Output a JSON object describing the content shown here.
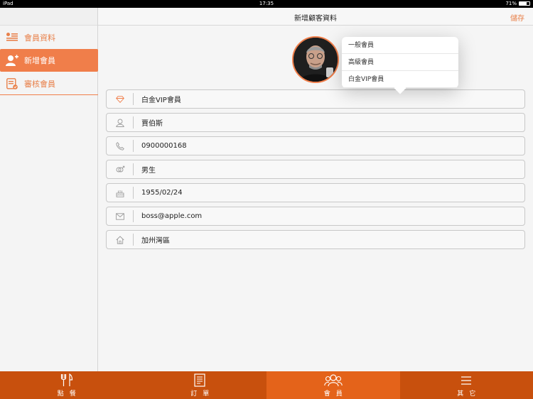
{
  "status_bar": {
    "device": "iPad",
    "time": "17:35",
    "battery": "71%"
  },
  "header": {
    "title": "新增顧客資料",
    "save_label": "儲存"
  },
  "sidebar": {
    "items": [
      {
        "label": "會員資料",
        "icon": "member-list-icon"
      },
      {
        "label": "新增會員",
        "icon": "add-member-icon"
      },
      {
        "label": "審核會員",
        "icon": "review-member-icon"
      }
    ],
    "active_index": 1
  },
  "popover": {
    "options": [
      {
        "label": "一般會員"
      },
      {
        "label": "高級會員"
      },
      {
        "label": "白金VIP會員"
      }
    ]
  },
  "form": {
    "fields": [
      {
        "value": "白金VIP會員",
        "icon": "diamond-icon"
      },
      {
        "value": "賈伯斯",
        "icon": "person-icon"
      },
      {
        "value": "0900000168",
        "icon": "phone-icon"
      },
      {
        "value": "男生",
        "icon": "gender-icon"
      },
      {
        "value": "1955/02/24",
        "icon": "birthday-cake-icon"
      },
      {
        "value": "boss@apple.com",
        "icon": "mail-icon"
      },
      {
        "value": "加州灣區",
        "icon": "home-icon"
      }
    ]
  },
  "tabbar": {
    "tabs": [
      {
        "label": "點餐",
        "icon": "fork-knife-icon"
      },
      {
        "label": "訂單",
        "icon": "order-list-icon"
      },
      {
        "label": "會員",
        "icon": "members-icon"
      },
      {
        "label": "其它",
        "icon": "menu-icon"
      }
    ],
    "active_index": 2
  },
  "colors": {
    "accent": "#f07e4a",
    "tabbar": "#c8500d",
    "tabbar_active": "#e4631a"
  }
}
